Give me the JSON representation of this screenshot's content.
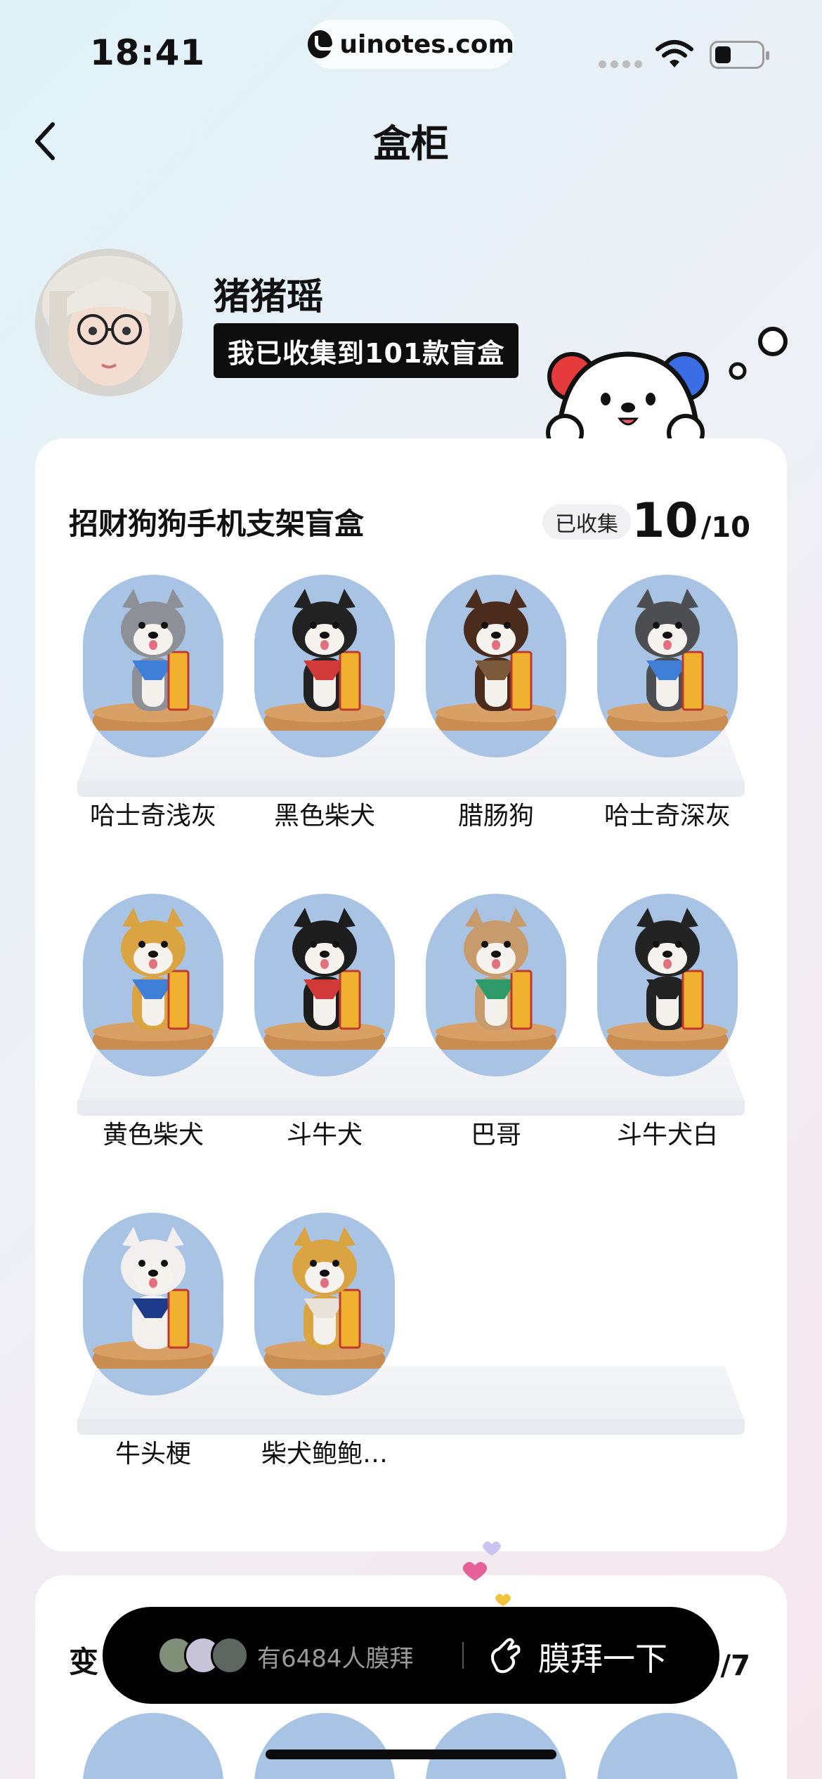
{
  "status_bar": {
    "time": "18:41",
    "url": "uinotes.com"
  },
  "header": {
    "title": "盒柜",
    "back_icon": "chevron-left-icon"
  },
  "profile": {
    "username": "猪猪瑶",
    "collect_text": "我已收集到101款盲盒"
  },
  "series": {
    "title": "招财狗狗手机支架盲盒",
    "collected_label": "已收集",
    "collected_count": "10",
    "total": "/10",
    "items": [
      {
        "name": "哈士奇浅灰",
        "color": "#8d9096"
      },
      {
        "name": "黑色柴犬",
        "color": "#222222"
      },
      {
        "name": "腊肠狗",
        "color": "#4a2b1c"
      },
      {
        "name": "哈士奇深灰",
        "color": "#4c4e52"
      },
      {
        "name": "黄色柴犬",
        "color": "#d9a441"
      },
      {
        "name": "斗牛犬",
        "color": "#1d1d1d"
      },
      {
        "name": "巴哥",
        "color": "#c79b6c"
      },
      {
        "name": "斗牛犬白",
        "color": "#232323"
      },
      {
        "name": "牛头梗",
        "color": "#f2efee"
      },
      {
        "name": "柴犬鲍鲍…",
        "color": "#d9a441"
      }
    ]
  },
  "second_series": {
    "title_partial": "变",
    "count_partial": "/7"
  },
  "worship": {
    "count_text": "有6484人膜拜",
    "action": "膜拜一下"
  }
}
